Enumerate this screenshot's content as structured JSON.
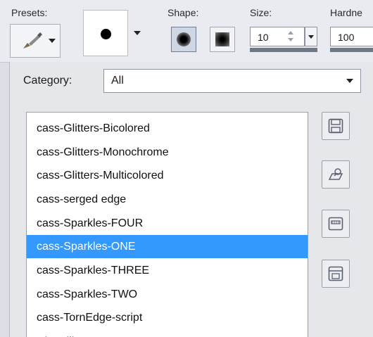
{
  "toolbar": {
    "presets_label": "Presets:",
    "shape_label": "Shape:",
    "size_label": "Size:",
    "hardness_label": "Hardne",
    "size_value": "10",
    "hardness_value": "100"
  },
  "dialog": {
    "category_label": "Category:",
    "category_value": "All",
    "brushes": [
      "cass-Glitters-Bicolored",
      "cass-Glitters-Monochrome",
      "cass-Glitters-Multicolored",
      "cass-serged edge",
      "cass-Sparkles-FOUR",
      "cass-Sparkles-ONE",
      "cass-Sparkles-THREE",
      "cass-Sparkles-TWO",
      "cass-TornEdge-script",
      "Chevrilles"
    ],
    "selected_brush": "cass-Sparkles-ONE"
  },
  "icons": {
    "preset": "paintbrush-icon",
    "shape_round": "round-shape-icon",
    "shape_square": "square-shape-icon",
    "save": "save-icon",
    "edit": "edit-preset-icon",
    "run": "run-script-icon",
    "export": "export-icon"
  },
  "colors": {
    "selection": "#3399ff",
    "toolbar_bg": "#e9ebf0"
  }
}
